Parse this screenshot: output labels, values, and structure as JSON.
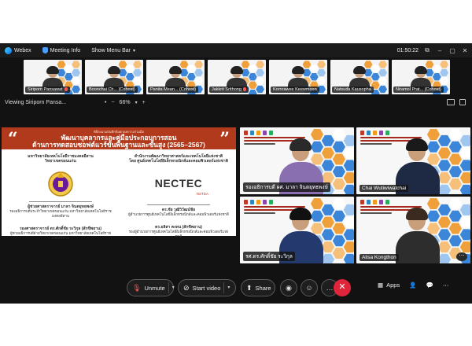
{
  "titlebar": {
    "app_name": "Webex",
    "meeting_info": "Meeting Info",
    "show_menu_bar": "Show Menu Bar",
    "timer": "01:50:22"
  },
  "participants_strip": [
    {
      "name": "Siriporn Pansawat",
      "muted": true
    },
    {
      "name": "Boonchai Ch... (Cohost)",
      "muted": false
    },
    {
      "name": "Panita Mean... (Cohost)",
      "muted": false
    },
    {
      "name": "Jakkrit Srithong",
      "muted": true
    },
    {
      "name": "Kornrawee Keewmoon",
      "muted": false
    },
    {
      "name": "Natsuda Kausopha",
      "muted": false
    },
    {
      "name": "Niramol Prat... (Cohost)",
      "muted": false
    }
  ],
  "viewbar": {
    "viewing": "Viewing Siriporn Pansa...",
    "zoom": "66%",
    "zoom_minus": "−",
    "zoom_plus": "+",
    "dot": "•"
  },
  "shared_slide": {
    "small_caption": "พิธีลงนามบันทึกข้อตกลงความร่วมมือ",
    "title_line1": "พัฒนาบุคลากรและคู่มือประกอบการสอน",
    "title_line2": "ด้านการทดสอบซอฟต์แวร์ขั้นพื้นฐานและขั้นสูง (2565–2567)",
    "left_org_line1": "มหาวิทยาลัยเทคโนโลยีราชมงคลอีสาน",
    "left_org_line2": "วิทยาเขตขอนแก่น",
    "left_signer1": "ผู้ช่วยศาสตราจารย์ มาลา จินตยุทธพงษ์",
    "left_signer1_role": "รองอธิการบดีประจำวิทยาเขตขอนแก่น มหาวิทยาลัยเทคโนโลยีราชมงคลอีสาน",
    "left_signer2": "รองศาสตราจารย์ ดร.ศักดิ์ชัย ระวิกุล (สักขีพยาน)",
    "left_signer2_role": "ผู้ช่วยอธิการบดีฝ่ายวิทยาเขตขอนแก่น มหาวิทยาลัยเทคโนโลยีราชมงคลอีสาน",
    "right_org_line1": "สำนักงานพัฒนาวิทยาศาสตร์และเทคโนโลยีแห่งชาติ",
    "right_org_line2": "โดย ศูนย์เทคโนโลยีอิเล็กทรอนิกส์และคอมพิวเตอร์แห่งชาติ",
    "right_logo_main": "NECTEC",
    "right_logo_sub": "NSTDA",
    "right_signer1": "ดร.ชัย วุฒิวิวัฒน์ชัย",
    "right_signer1_role": "ผู้อำนวยการศูนย์เทคโนโลยีอิเล็กทรอนิกส์และคอมพิวเตอร์แห่งชาติ",
    "right_signer2": "ดร.อลิสา คงทน (สักขีพยาน)",
    "right_signer2_role": "รองผู้อำนวยการศูนย์เทคโนโลยีอิเล็กทรอนิกส์และคอมพิวเตอร์แห่งชาติ"
  },
  "gallery": [
    {
      "name": "รองอธิการบดี ผศ. มาลา จินตยุทธพงษ์",
      "shirt": "#8a6fb0",
      "hair": "#2a2a2a"
    },
    {
      "name": "Chai Wutiwiwatchai",
      "shirt": "#1e2a44",
      "hair": "#1a1a1a"
    },
    {
      "name": "รศ.ดร.ศักดิ์ชัย ระวิกุล",
      "shirt": "#243a6e",
      "hair": "#111111"
    },
    {
      "name": "Alisa Kongthon",
      "shirt": "#2d2d2d",
      "hair": "#3a2a20"
    }
  ],
  "toolbar": {
    "unmute": "Unmute",
    "start_video": "Start video",
    "share": "Share",
    "apps": "Apps"
  },
  "colors": {
    "slide_banner": "#b23a1c",
    "leave_button": "#e0243a",
    "hex_orange": "#f0a03a",
    "hex_blue": "#3b86d8"
  }
}
